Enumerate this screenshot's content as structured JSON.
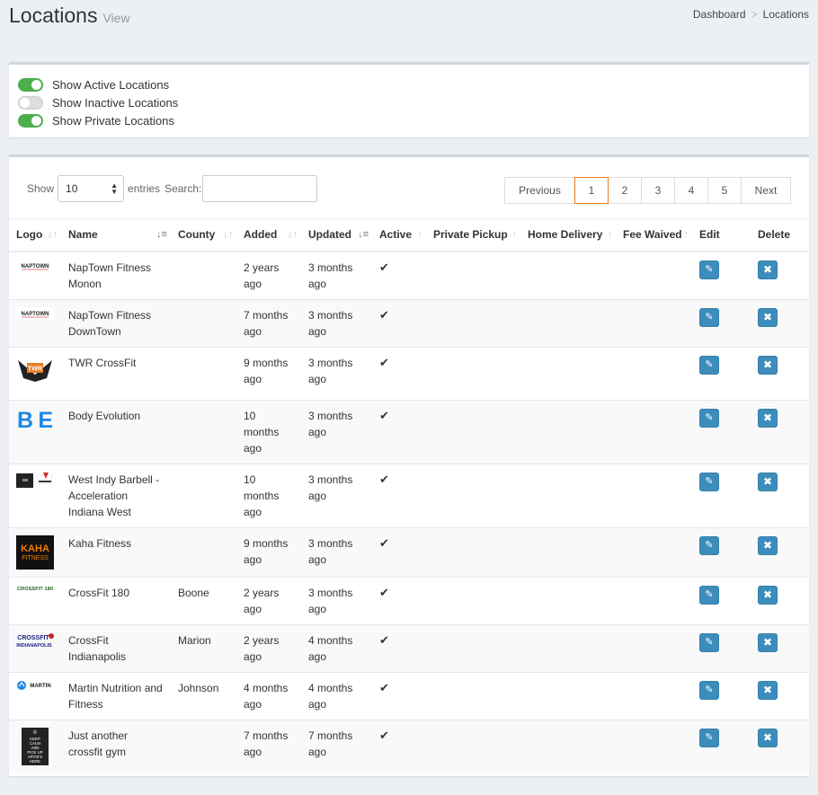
{
  "header": {
    "title": "Locations",
    "subtitle": "View"
  },
  "breadcrumb": {
    "items": [
      "Dashboard",
      "Locations"
    ]
  },
  "filters": [
    {
      "label": "Show Active Locations",
      "on": true
    },
    {
      "label": "Show Inactive Locations",
      "on": false
    },
    {
      "label": "Show Private Locations",
      "on": true
    }
  ],
  "controls": {
    "show_label": "Show",
    "entries_value": "10",
    "entries_label": "entries",
    "search_label": "Search:",
    "search_value": ""
  },
  "pagination": {
    "previous": "Previous",
    "pages": [
      "1",
      "2",
      "3",
      "4",
      "5"
    ],
    "current": "1",
    "next": "Next"
  },
  "columns": [
    "Logo",
    "Name",
    "County",
    "Added",
    "Updated",
    "Active",
    "Private Pickup",
    "Home Delivery",
    "Fee Waived",
    "Edit",
    "Delete"
  ],
  "rows": [
    {
      "logo": "NAPTOWN",
      "name": "NapTown Fitness Monon",
      "county": "",
      "added": "2 years ago",
      "updated": "3 months ago",
      "active": true
    },
    {
      "logo": "NAPTOWN",
      "name": "NapTown Fitness DownTown",
      "county": "",
      "added": "7 months ago",
      "updated": "3 months ago",
      "active": true
    },
    {
      "logo": "TWR",
      "name": "TWR CrossFit",
      "county": "",
      "added": "9 months ago",
      "updated": "3 months ago",
      "active": true
    },
    {
      "logo": "BE",
      "name": "Body Evolution",
      "county": "",
      "added": "10 months ago",
      "updated": "3 months ago",
      "active": true
    },
    {
      "logo": "",
      "name": "West Indy Barbell - Acceleration Indiana West",
      "county": "",
      "added": "10 months ago",
      "updated": "3 months ago",
      "active": true
    },
    {
      "logo": "KAHA FITNESS",
      "name": "Kaha Fitness",
      "county": "",
      "added": "9 months ago",
      "updated": "3 months ago",
      "active": true
    },
    {
      "logo": "CROSSFIT 180",
      "name": "CrossFit 180",
      "county": "Boone",
      "added": "2 years ago",
      "updated": "3 months ago",
      "active": true
    },
    {
      "logo": "CROSSFIT INDIANAPOLIS",
      "name": "CrossFit Indianapolis",
      "county": "Marion",
      "added": "2 years ago",
      "updated": "4 months ago",
      "active": true
    },
    {
      "logo": "MARTIN",
      "name": "Martin Nutrition and Fitness",
      "county": "Johnson",
      "added": "4 months ago",
      "updated": "4 months ago",
      "active": true
    },
    {
      "logo": "KEEP CALM AND PICK UP ARTIE'S HERE",
      "name": "Just another crossfit gym",
      "county": "",
      "added": "7 months ago",
      "updated": "7 months ago",
      "active": true
    }
  ],
  "icons": {
    "check": "check-icon",
    "edit": "pencil-icon",
    "delete": "times-icon"
  },
  "colors": {
    "accent": "#3c8dbc",
    "toggle_on": "#4cae4c",
    "active_page_border": "#e67e22"
  }
}
